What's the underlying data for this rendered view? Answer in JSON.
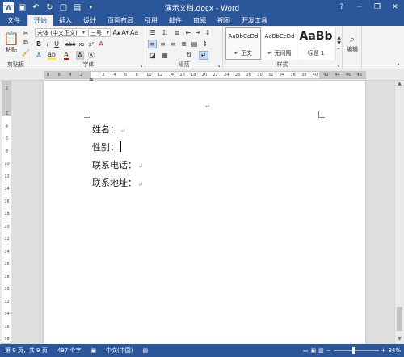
{
  "titlebar": {
    "title": "演示文档.docx - Word",
    "qa_icons": [
      "word-icon",
      "save-icon",
      "undo-icon",
      "redo-icon",
      "new-doc-icon",
      "print-preview-icon"
    ],
    "help": "?",
    "minimize": "─",
    "restore": "❐",
    "close": "✕"
  },
  "tabs": [
    {
      "label": "文件"
    },
    {
      "label": "开始"
    },
    {
      "label": "插入"
    },
    {
      "label": "设计"
    },
    {
      "label": "页面布局"
    },
    {
      "label": "引用"
    },
    {
      "label": "邮件"
    },
    {
      "label": "审阅"
    },
    {
      "label": "视图"
    },
    {
      "label": "开发工具"
    }
  ],
  "ribbon": {
    "clipboard": {
      "label": "剪贴板",
      "paste": "粘贴"
    },
    "font": {
      "label": "字体",
      "font_name": "宋体 (中文正文)",
      "font_size": "三号"
    },
    "paragraph": {
      "label": "段落"
    },
    "styles": {
      "label": "样式",
      "items": [
        {
          "sample": "AaBbCcDd",
          "name": "↵ 正文"
        },
        {
          "sample": "AaBbCcDd",
          "name": "↵ 无间隔"
        },
        {
          "sample": "AaBb",
          "name": "标题 1"
        }
      ]
    },
    "editing": {
      "label": "编辑"
    }
  },
  "ruler": {
    "h_ticks": [
      "8",
      "6",
      "4",
      "2",
      "",
      "2",
      "4",
      "6",
      "8",
      "10",
      "12",
      "14",
      "16",
      "18",
      "20",
      "22",
      "24",
      "26",
      "28",
      "30",
      "32",
      "34",
      "36",
      "38",
      "40",
      "42",
      "44",
      "46",
      "48"
    ],
    "v_ticks": [
      "2",
      "",
      "2",
      "4",
      "6",
      "8",
      "10",
      "12",
      "14",
      "16",
      "18",
      "20",
      "22",
      "24",
      "26",
      "28",
      "30",
      "32",
      "34",
      "36",
      "38"
    ],
    "corner": "L"
  },
  "document": {
    "lines": [
      {
        "text": "姓名："
      },
      {
        "text": "性别："
      },
      {
        "text": "联系电话："
      },
      {
        "text": "联系地址："
      }
    ],
    "para_mark": "↵"
  },
  "status": {
    "page": "第 9 页，共 9 页",
    "words": "497 个字",
    "lang": "中文(中国)",
    "zoom": "84%",
    "zoom_level": 0.45
  }
}
